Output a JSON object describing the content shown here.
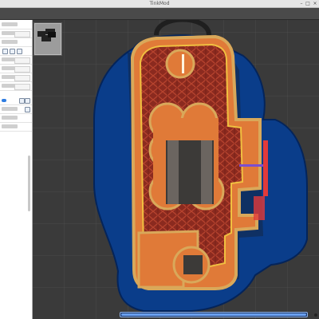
{
  "window": {
    "title": "TinkMod",
    "controls": {
      "minimize": "–",
      "maximize": "□",
      "close": "×"
    }
  },
  "viewport": {
    "mode": "layer-preview",
    "colors": {
      "background": "#3a3a3a",
      "grid": "#4f4f4f",
      "raft": "#0a3d8a",
      "raft_edge": "#04245a",
      "wall": "#d9a85a",
      "infill": "#8b2a1f",
      "solid": "#e07a38",
      "highlight": "#f0c040",
      "accent_red": "#e23a3a",
      "accent_purple": "#7a4fd0"
    }
  },
  "sidebar": {
    "thumbnail_icon": "document-icon"
  },
  "status": {
    "progress": 1.0
  }
}
